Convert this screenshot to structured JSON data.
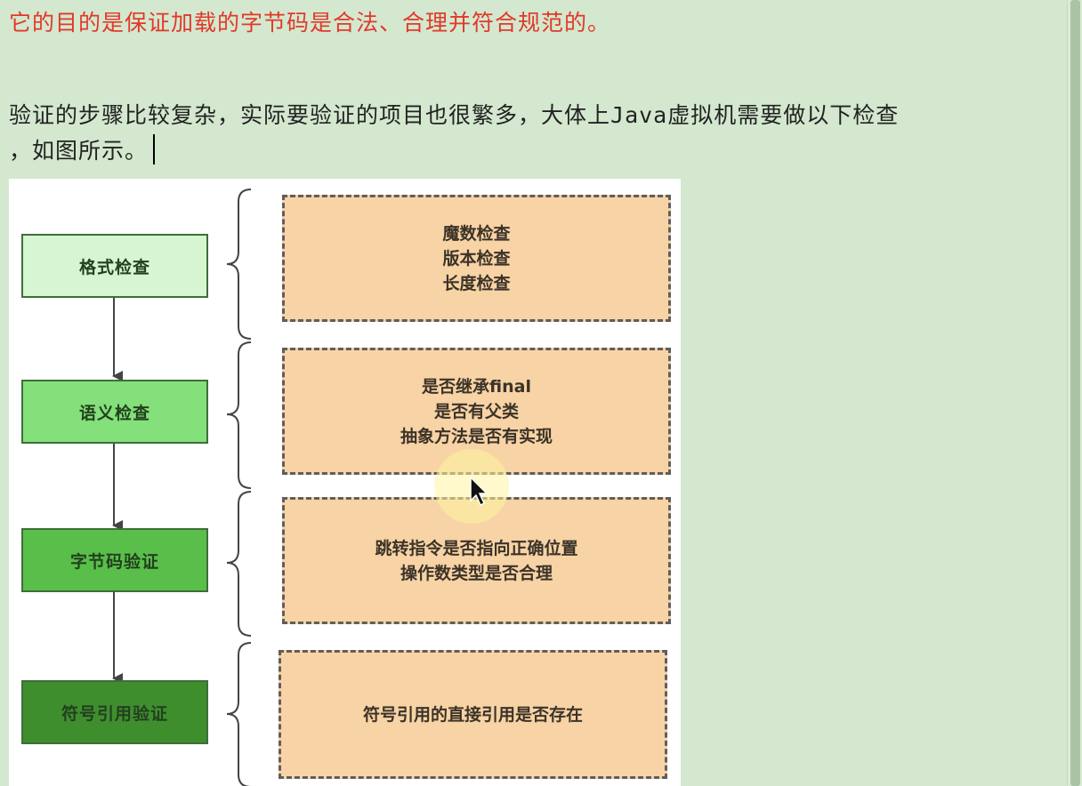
{
  "document": {
    "highlight_line": "它的目的是保证加载的字节码是合法、合理并符合规范的。",
    "paragraph_before_java": "验证的步骤比较复杂，实际要验证的项目也很繁多，大体上",
    "paragraph_java": "Java",
    "paragraph_after_java": "虚拟机需要做以下检查",
    "paragraph_line2": "，如图所示。"
  },
  "figure": {
    "steps": [
      {
        "label": "格式检查",
        "color": "#d6f5d1"
      },
      {
        "label": "语义检查",
        "color": "#83e07a"
      },
      {
        "label": "字节码验证",
        "color": "#5abf4a"
      },
      {
        "label": "符号引用验证",
        "color": "#3f8e2e"
      }
    ],
    "details": [
      {
        "lines": [
          "魔数检查",
          "版本检查",
          "长度检查"
        ]
      },
      {
        "lines": [
          "是否继承final",
          "是否有父类",
          "抽象方法是否有实现"
        ]
      },
      {
        "lines": [
          "跳转指令是否指向正确位置",
          "操作数类型是否合理"
        ]
      },
      {
        "lines": [
          "符号引用的直接引用是否存在"
        ]
      }
    ]
  }
}
